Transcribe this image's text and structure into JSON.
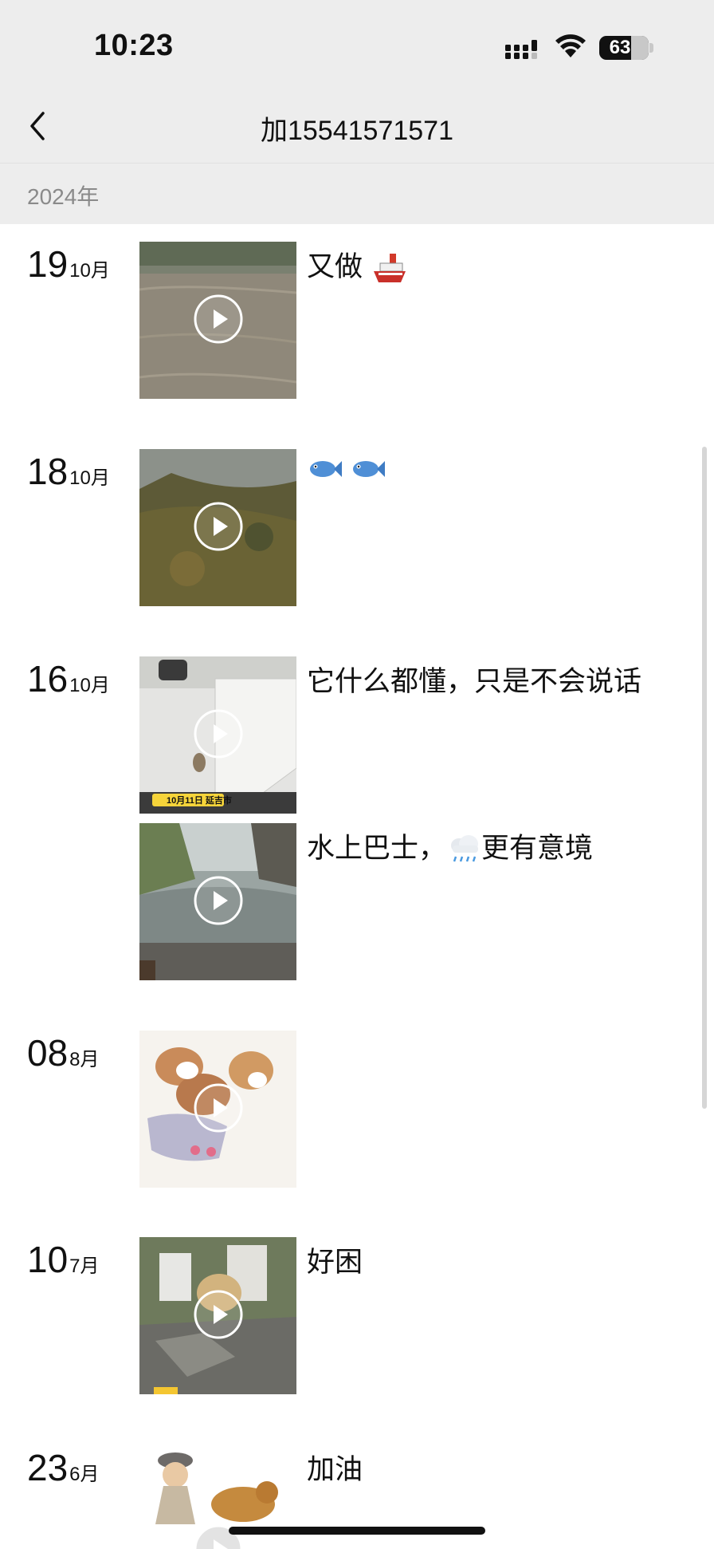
{
  "status_bar": {
    "time": "10:23",
    "battery": "63",
    "icons": [
      "cellular-signal-icon",
      "wifi-icon",
      "battery-icon"
    ]
  },
  "nav": {
    "back_icon": "chevron-left-icon",
    "title": "加15541571571"
  },
  "year_label": "2024年",
  "posts": [
    {
      "day": "19",
      "month": "10月",
      "caption": "又做",
      "emoji": [
        "ship-emoji"
      ],
      "media": "video"
    },
    {
      "day": "18",
      "month": "10月",
      "caption": "",
      "emoji": [
        "fish-emoji",
        "fish-emoji"
      ],
      "media": "video"
    },
    {
      "day": "16",
      "month": "10月",
      "caption": "它什么都懂，只是不会说话",
      "media": "video",
      "overlay_text": "10月11日 延吉市"
    },
    {
      "day": "",
      "month": "",
      "caption_before": "水上巴士，",
      "emoji": [
        "rain-cloud-emoji"
      ],
      "caption_after": "更有意境",
      "media": "video"
    },
    {
      "day": "08",
      "month": "8月",
      "caption": "",
      "media": "video"
    },
    {
      "day": "10",
      "month": "7月",
      "caption": "好困",
      "media": "video"
    },
    {
      "day": "23",
      "month": "6月",
      "caption": "加油",
      "media": "video"
    }
  ],
  "colors": {
    "header_bg": "#ededed",
    "year_text": "#8a8a8a",
    "text": "#111111",
    "scrollbar": "#d6d6d6"
  }
}
